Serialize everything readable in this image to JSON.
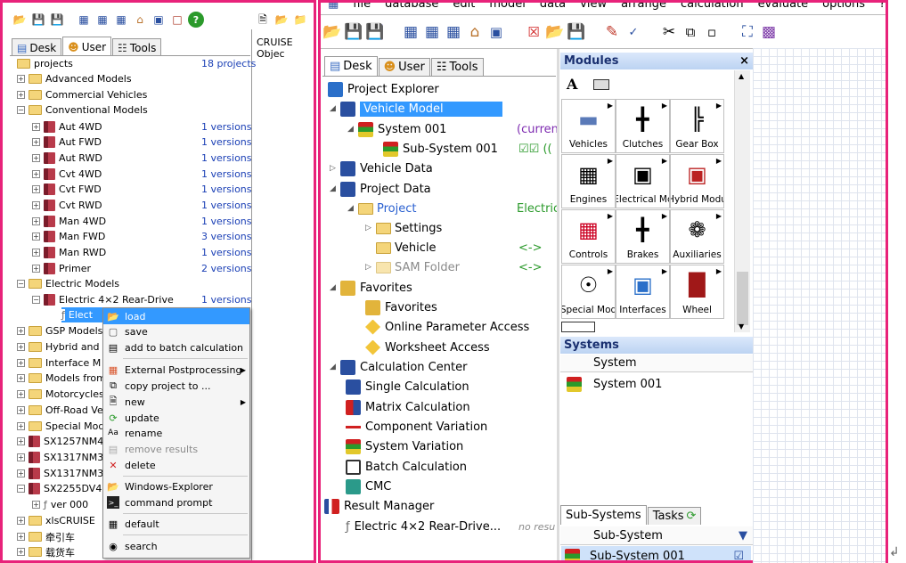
{
  "left": {
    "tabs": [
      "Desk",
      "User",
      "Tools"
    ],
    "side_label": "CRUISE Objec",
    "tree": [
      {
        "label": "projects",
        "count": "18 projects"
      },
      {
        "label": "Advanced Models"
      },
      {
        "label": "Commercial Vehicles"
      },
      {
        "label": "Conventional Models"
      },
      {
        "label": "Aut 4WD",
        "ver": "1 versions"
      },
      {
        "label": "Aut FWD",
        "ver": "1 versions"
      },
      {
        "label": "Aut RWD",
        "ver": "1 versions"
      },
      {
        "label": "Cvt 4WD",
        "ver": "1 versions"
      },
      {
        "label": "Cvt FWD",
        "ver": "1 versions"
      },
      {
        "label": "Cvt RWD",
        "ver": "1 versions"
      },
      {
        "label": "Man 4WD",
        "ver": "1 versions"
      },
      {
        "label": "Man FWD",
        "ver": "3 versions"
      },
      {
        "label": "Man RWD",
        "ver": "1 versions"
      },
      {
        "label": "Primer",
        "ver": "2 versions"
      },
      {
        "label": "Electric Models"
      },
      {
        "label": "Electric 4×2 Rear-Drive",
        "ver": "1 versions"
      },
      {
        "label": "Elect"
      },
      {
        "label": "GSP Models"
      },
      {
        "label": "Hybrid and I"
      },
      {
        "label": "Interface M"
      },
      {
        "label": "Models from"
      },
      {
        "label": "Motorcycles"
      },
      {
        "label": "Off-Road Ve"
      },
      {
        "label": "Special Mod"
      },
      {
        "label": "SX1257NM4"
      },
      {
        "label": "SX1317NM3"
      },
      {
        "label": "SX1317NM3"
      },
      {
        "label": "SX2255DV4"
      },
      {
        "label": "ver 000"
      },
      {
        "label": "xlsCRUISE"
      },
      {
        "label": "牵引车"
      },
      {
        "label": "载货车"
      }
    ],
    "context_menu": [
      "load",
      "save",
      "add to batch calculation",
      "External Postprocessing",
      "copy project to ...",
      "new",
      "update",
      "rename",
      "remove results",
      "delete",
      "Windows-Explorer",
      "command prompt",
      "default",
      "search"
    ]
  },
  "right": {
    "menubar": [
      "file",
      "database",
      "edit",
      "model",
      "data",
      "view",
      "arrange",
      "calculation",
      "evaluate",
      "options",
      "?"
    ],
    "tabs": [
      "Desk",
      "User",
      "Tools"
    ],
    "tree": [
      {
        "label": "Project Explorer"
      },
      {
        "label": "Vehicle Model"
      },
      {
        "label": "System 001",
        "extra": "(curren"
      },
      {
        "label": "Sub-System 001",
        "extra": "☑☑ (("
      },
      {
        "label": "Vehicle Data"
      },
      {
        "label": "Project Data"
      },
      {
        "label": "Project",
        "extra": "Electric"
      },
      {
        "label": "Settings"
      },
      {
        "label": "Vehicle",
        "extra": "<->"
      },
      {
        "label": "SAM Folder",
        "extra": "<->"
      },
      {
        "label": "Favorites"
      },
      {
        "label": "Favorites"
      },
      {
        "label": "Online Parameter Access"
      },
      {
        "label": "Worksheet Access"
      },
      {
        "label": "Calculation Center"
      },
      {
        "label": "Single Calculation"
      },
      {
        "label": "Matrix Calculation"
      },
      {
        "label": "Component Variation"
      },
      {
        "label": "System Variation"
      },
      {
        "label": "Batch Calculation"
      },
      {
        "label": "CMC"
      },
      {
        "label": "Result Manager"
      },
      {
        "label": "Electric 4×2 Rear-Drive...",
        "extra": "no resu"
      }
    ],
    "modules": {
      "title": "Modules",
      "close": "×",
      "text_tool": "A",
      "cells": [
        "Vehicles",
        "Clutches",
        "Gear Box",
        "Engines",
        "Electrical Mc",
        "Hybrid Modu",
        "Controls",
        "Brakes",
        "Auxiliaries",
        "Special Mod",
        "Interfaces",
        "Wheel"
      ]
    },
    "systems": {
      "title": "Systems",
      "column": "System",
      "rows": [
        "System 001"
      ]
    },
    "subsystems": {
      "tabs": [
        "Sub-Systems",
        "Tasks"
      ],
      "column": "Sub-System",
      "rows": [
        "Sub-System 001"
      ]
    },
    "accent_color": "#e8227a"
  }
}
